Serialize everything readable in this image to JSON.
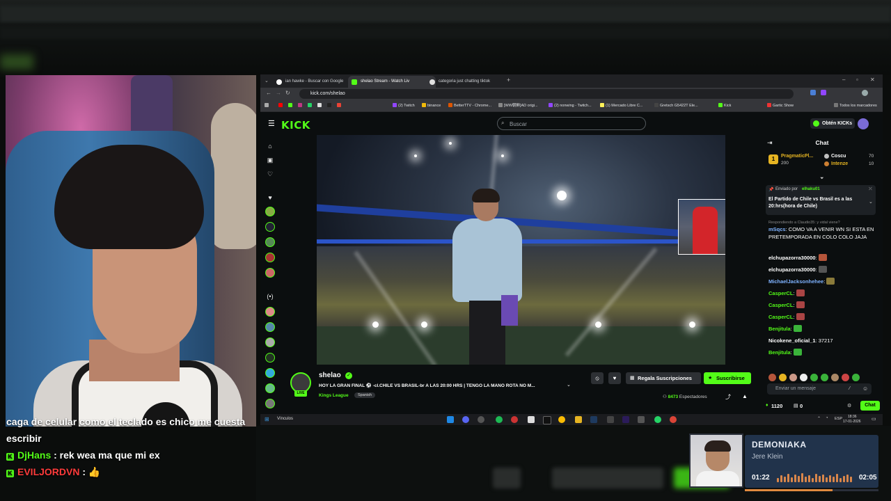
{
  "overlay_chat": {
    "line1": "caga de celular como el teclado es chico me cuesta",
    "line2": "escribir",
    "msg1": {
      "user": "DjHans",
      "text": ": rek wea ma que mi ex"
    },
    "msg2": {
      "user": "EVILJORDVN",
      "text": ":"
    }
  },
  "browser": {
    "tabs": [
      {
        "label": "ian hawke - Buscar con Google"
      },
      {
        "label": "shelao Stream - Watch Liv"
      },
      {
        "label": "categoria just chatting tiktok"
      }
    ],
    "url": "kick.com/shelao",
    "bookmarks": [
      "(2) Twitch",
      "binance",
      "BetterTTV - Chrome...",
      "[WW朝鮮]AD origi...",
      "(2) nonwing - Twitch...",
      "(1) Mercado Libre C...",
      "Gretsch G5422T Ele...",
      "Kick",
      "Gartic Show",
      "Todos los marcadores"
    ]
  },
  "kick": {
    "logo": "KICK",
    "search_placeholder": "Buscar",
    "get_kicks": "Obtén KICKs",
    "channel": "shelao",
    "live_badge": "LIVE",
    "stream_title": "HOY LA GRAN FINAL ⚽ -cl.CHILE VS BRASIL-br A LAS 20:00 HRS | TENGO LA MANO ROTA NO M...",
    "category": "Kings League",
    "tag": "Spanish",
    "regala": "Regala Suscripciones",
    "subscribe": "Suscribirse",
    "viewers_count": "8473",
    "viewers_label": "Espectadores"
  },
  "chat": {
    "title": "Chat",
    "leaders": [
      {
        "rank": "1",
        "name": "PragmaticPl...",
        "value": "200"
      },
      {
        "name": "Coscu",
        "value": "70"
      },
      {
        "name": "Intenze",
        "value": "10"
      }
    ],
    "pinned": {
      "by_label": "Enviado por",
      "by_user": "elhaku01",
      "text": "El Partido de Chile vs Brasil es a las 20:hrs(hora de Chile)"
    },
    "reply_note": "Respondiendo a Claudio35: y vidal viene?",
    "messages": [
      {
        "user": "mSqcs",
        "text": ": COMO VA A VENIR WN SI ESTA EN PRETEMPORADA EN COLO COLO JAJA"
      },
      {
        "user": "elchupazorra30000",
        "text": ":"
      },
      {
        "user": "elchupazorra30000",
        "text": ":"
      },
      {
        "user": "MichaelJacksonhehee",
        "text": ":"
      },
      {
        "user": "CasperCL",
        "text": ":"
      },
      {
        "user": "CasperCL",
        "text": ":"
      },
      {
        "user": "CasperCL",
        "text": ":"
      },
      {
        "user": "Benjitula",
        "text": ":"
      },
      {
        "user": "Nicokene_oficial_1",
        "text": ": 37217"
      },
      {
        "user": "Benjitula",
        "text": ":"
      }
    ],
    "input_placeholder": "Enviar un mensaje",
    "points": "1120",
    "points2": "0",
    "send_label": "Chat"
  },
  "taskbar": {
    "search_label": "Vínculos",
    "lang": "ESP",
    "time": "18:36",
    "date": "17-01-2026"
  },
  "music": {
    "title": "DEMONIAKA",
    "artist": "Jere Klein",
    "current": "01:22",
    "total": "02:05",
    "progress": 0.656
  },
  "colors": {
    "kick_green": "#53fc18",
    "chat_bg": "#0b0e0f",
    "music_panel": "#263a56"
  }
}
